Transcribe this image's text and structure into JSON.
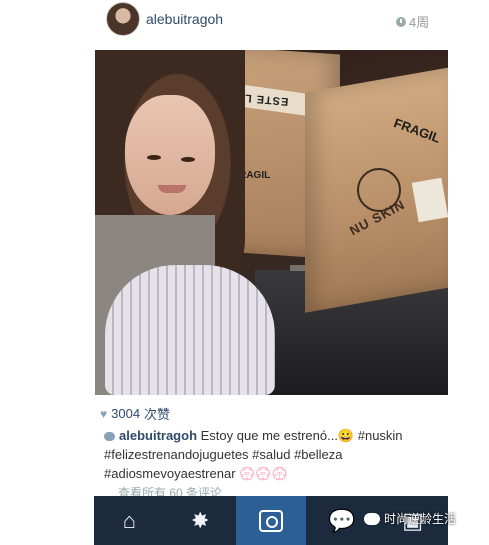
{
  "header": {
    "username": "alebuitragoh",
    "time": "4周",
    "clock_icon": "clock-icon"
  },
  "photo": {
    "box_label": "ESTE LA",
    "box_fragil_1": "FRAGIL",
    "box_fragil_2": "FRAGIL",
    "box_brand": "NU SKIN"
  },
  "likes": {
    "icon": "heart-icon",
    "count": "3004",
    "suffix": "次赞"
  },
  "caption": {
    "user": "alebuitragoh",
    "text": "Estoy que me estrenó...😀 #nuskin #felizestrenandojuguetes #salud #belleza #adiosmevoyaestrenar 💮💮💮"
  },
  "comments": {
    "view_all": "查看所有 60 条评论"
  },
  "tabbar": {
    "items": [
      {
        "icon": "home-icon",
        "glyph": "⌂"
      },
      {
        "icon": "explore-icon",
        "glyph": "✸"
      },
      {
        "icon": "camera-icon",
        "glyph": ""
      },
      {
        "icon": "chat-icon",
        "glyph": "💬"
      },
      {
        "icon": "profile-icon",
        "glyph": "▣"
      }
    ]
  },
  "watermark": {
    "text": "时尚逆龄生活"
  }
}
